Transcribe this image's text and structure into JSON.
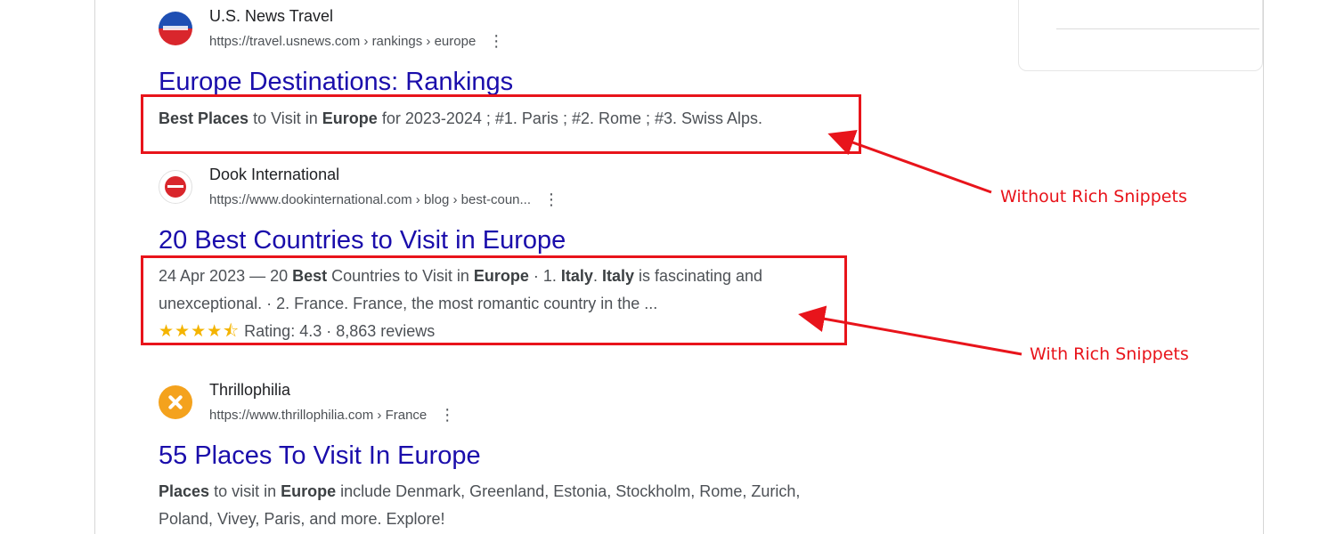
{
  "results": [
    {
      "site_name": "U.S. News Travel",
      "url": "https://travel.usnews.com › rankings › europe",
      "title": "Europe Destinations: Rankings",
      "favicon_icon": "usnews-logo-icon",
      "favicon_colors": [
        "#1e4fb3",
        "#d9262c"
      ],
      "snippet_lines": [
        [
          {
            "t": "Best Places",
            "b": true
          },
          {
            "t": " to Visit in ",
            "b": false
          },
          {
            "t": "Europe",
            "b": true
          },
          {
            "t": " for 2023-2024 ; #1. Paris ; #2. Rome ; #3. Swiss Alps.",
            "b": false
          }
        ]
      ]
    },
    {
      "site_name": "Dook International",
      "url": "https://www.dookinternational.com › blog › best-coun...",
      "title": "20 Best Countries to Visit in Europe",
      "favicon_icon": "dook-logo-icon",
      "favicon_colors": [
        "#d9262c"
      ],
      "snippet_lines": [
        [
          {
            "t": "24 Apr 2023 — 20 ",
            "b": false
          },
          {
            "t": "Best",
            "b": true
          },
          {
            "t": " Countries to Visit in ",
            "b": false
          },
          {
            "t": "Europe",
            "b": true
          },
          {
            "t": " · 1. ",
            "b": false
          },
          {
            "t": "Italy",
            "b": true
          },
          {
            "t": ". ",
            "b": false
          },
          {
            "t": "Italy",
            "b": true
          },
          {
            "t": " is fascinating and",
            "b": false
          }
        ],
        [
          {
            "t": "unexceptional. · 2. France. France, the most romantic country in the ...",
            "b": false
          }
        ]
      ],
      "rating": {
        "stars": "★★★★⯪",
        "value": 4.3,
        "label": "Rating: 4.3",
        "separator": " · ",
        "reviews": "8,863 reviews"
      }
    },
    {
      "site_name": "Thrillophilia",
      "url": "https://www.thrillophilia.com › France",
      "title": "55 Places To Visit In Europe",
      "favicon_icon": "thrillophilia-logo-icon",
      "favicon_colors": [
        "#f4a21d"
      ],
      "snippet_lines": [
        [
          {
            "t": "Places",
            "b": true
          },
          {
            "t": " to visit in ",
            "b": false
          },
          {
            "t": "Europe",
            "b": true
          },
          {
            "t": " include Denmark, Greenland, Estonia, Stockholm, Rome, Zurich,",
            "b": false
          }
        ],
        [
          {
            "t": "Poland, Vivey, Paris, and more. Explore!",
            "b": false
          }
        ]
      ]
    }
  ],
  "more_options_glyph": "⋮",
  "annotations": {
    "without_label": "Without Rich Snippets",
    "with_label": "With Rich Snippets",
    "color": "#e8141b"
  }
}
